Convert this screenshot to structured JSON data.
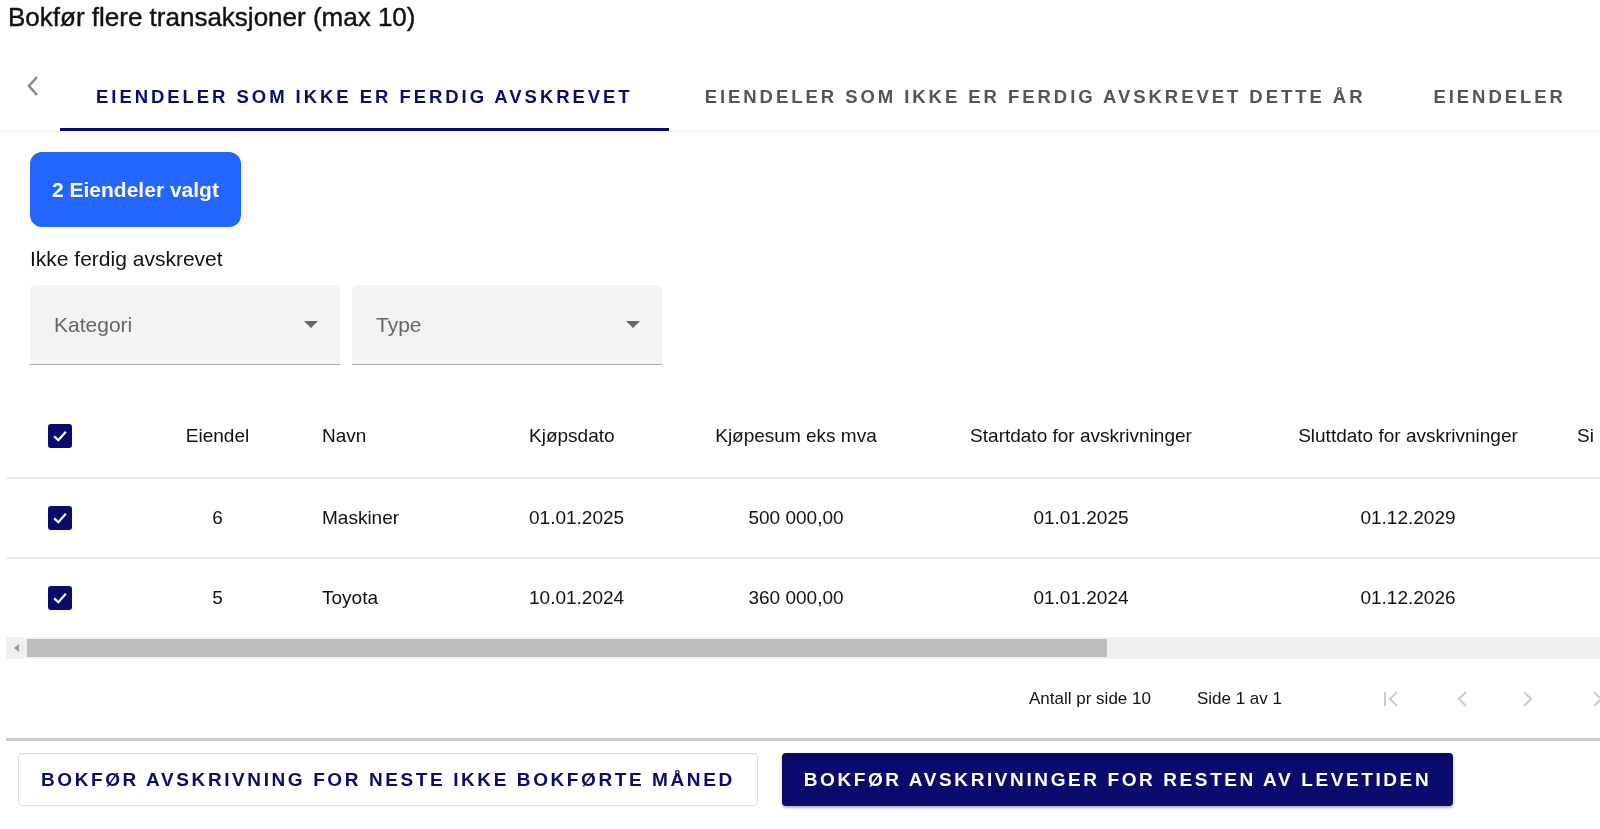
{
  "title": "Bokfør flere transaksjoner (max 10)",
  "tabs": [
    {
      "label": "EIENDELER SOM IKKE ER FERDIG AVSKREVET",
      "selected": true
    },
    {
      "label": "EIENDELER SOM IKKE ER FERDIG AVSKREVET DETTE ÅR",
      "selected": false
    },
    {
      "label": "EIENDELER",
      "selected": false
    }
  ],
  "selection_badge": "2 Eiendeler valgt",
  "filter_heading": "Ikke ferdig avskrevet",
  "filters": [
    {
      "placeholder": "Kategori"
    },
    {
      "placeholder": "Type"
    }
  ],
  "table": {
    "select_all_checked": true,
    "columns": [
      "Eiendel",
      "Navn",
      "Kjøpsdato",
      "Kjøpesum eks mva",
      "Startdato for avskrivninger",
      "Sluttdato for avskrivninger",
      "Si"
    ],
    "rows": [
      {
        "checked": true,
        "cells": [
          "6",
          "Maskiner",
          "01.01.2025",
          "500 000,00",
          "01.01.2025",
          "01.12.2029"
        ]
      },
      {
        "checked": true,
        "cells": [
          "5",
          "Toyota",
          "10.01.2024",
          "360 000,00",
          "01.01.2024",
          "01.12.2026"
        ]
      }
    ]
  },
  "pagination": {
    "per_page": "Antall pr side 10",
    "page": "Side 1 av 1"
  },
  "actions": [
    {
      "label": "BOKFØR AVSKRIVNING FOR NESTE IKKE BOKFØRTE MÅNED",
      "kind": "outlined"
    },
    {
      "label": "BOKFØR AVSKRIVNINGER FOR RESTEN AV LEVETIDEN",
      "kind": "filled"
    }
  ]
}
